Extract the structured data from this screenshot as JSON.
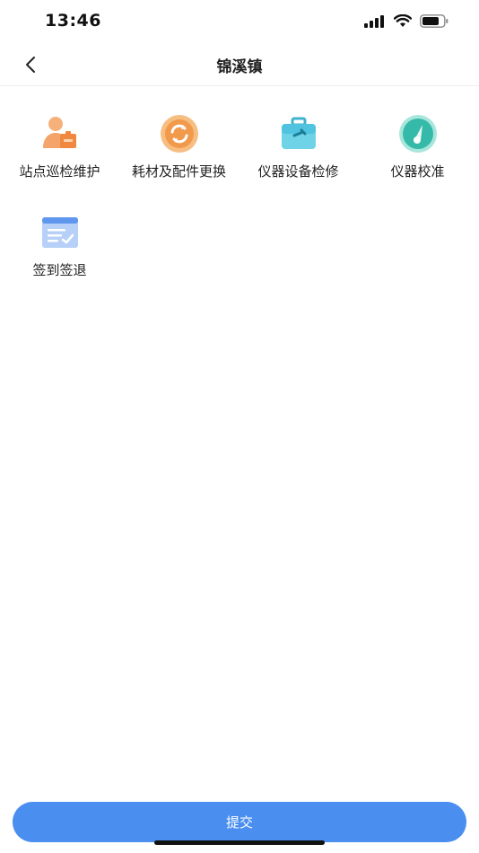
{
  "status": {
    "time": "13:46",
    "icons": [
      "signal-icon",
      "wifi-icon",
      "battery-icon"
    ]
  },
  "nav": {
    "title": "锦溪镇",
    "back_icon": "chevron-left-icon"
  },
  "menu": [
    {
      "label": "站点巡检维护",
      "icon": "person-box-icon",
      "color": "#f29a57"
    },
    {
      "label": "耗材及配件更换",
      "icon": "replace-cycle-icon",
      "color": "#f3a35d"
    },
    {
      "label": "仪器设备检修",
      "icon": "toolbox-icon",
      "color": "#4fc6de"
    },
    {
      "label": "仪器校准",
      "icon": "gauge-icon",
      "color": "#3fc3b4"
    },
    {
      "label": "签到签退",
      "icon": "checklist-icon",
      "color": "#6b9ff0"
    }
  ],
  "submit": {
    "label": "提交",
    "color": "#4a8ef0"
  }
}
